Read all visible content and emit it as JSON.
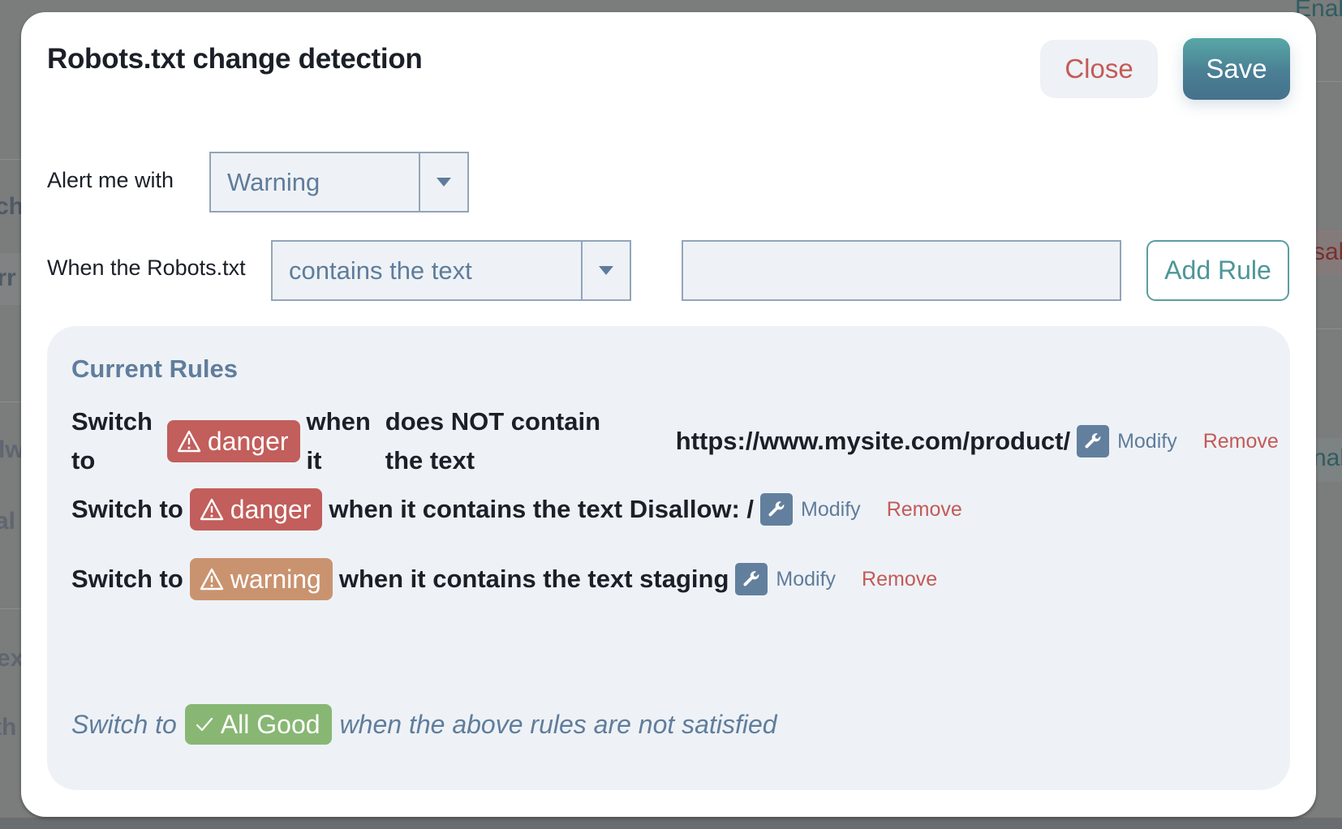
{
  "background": {
    "fragments": [
      "Enab",
      "ch",
      "urr",
      "sal",
      "lw",
      "al",
      "nab",
      "ex",
      "th"
    ]
  },
  "modal": {
    "title": "Robots.txt change detection",
    "close_label": "Close",
    "save_label": "Save"
  },
  "form": {
    "alert_label": "Alert me with",
    "alert_value": "Warning",
    "condition_label": "When the Robots.txt",
    "condition_value": "contains the text",
    "text_value": "",
    "text_placeholder": "",
    "add_rule_label": "Add Rule"
  },
  "rules": {
    "title": "Current Rules",
    "items": [
      {
        "prefix_line1": "Switch",
        "prefix_line2": "to",
        "level": "danger",
        "level_icon": "warning-triangle-icon",
        "when_line1": "when",
        "when_line2": "it",
        "condition_line1": "does NOT contain",
        "condition_line2": "the text",
        "value": "https://www.mysite.com/product/",
        "modify_label": "Modify",
        "remove_label": "Remove"
      },
      {
        "prefix": "Switch to",
        "level": "danger",
        "level_icon": "warning-triangle-icon",
        "description": "when it contains the text Disallow: /",
        "modify_label": "Modify",
        "remove_label": "Remove"
      },
      {
        "prefix": "Switch to",
        "level": "warning",
        "level_icon": "warning-triangle-icon",
        "description": "when it contains the text staging",
        "modify_label": "Modify",
        "remove_label": "Remove"
      }
    ],
    "default": {
      "prefix": "Switch to",
      "level": "All Good",
      "level_icon": "check-icon",
      "suffix": "when the above rules are not satisfied"
    }
  },
  "colors": {
    "danger": "#c25e5b",
    "warning": "#c9936f",
    "good": "#88b774",
    "accent": "#4d9699",
    "muted_blue": "#5f7c9b"
  }
}
